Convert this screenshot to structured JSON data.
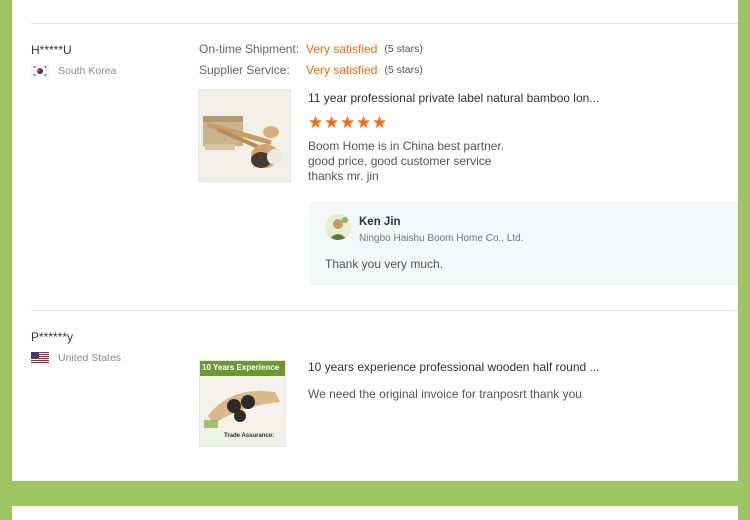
{
  "reviews": [
    {
      "user": "H*****U",
      "country": "South Korea",
      "ratings": [
        {
          "label": "On-time Shipment:",
          "value": "Very satisfied",
          "stars": "(5 stars)"
        },
        {
          "label": "Supplier Service:",
          "value": "Very satisfied",
          "stars": "(5 stars)"
        }
      ],
      "product_title": "11 year professional private label natural bamboo lon...",
      "star_rating": 5,
      "review_lines": [
        "Boom Home is in China best partner.",
        "good price, good customer service",
        "thanks mr. jin"
      ],
      "reply": {
        "name": "Ken Jin",
        "company": "Ningbo Haishu Boom Home Co., Ltd.",
        "text": "Thank you very much."
      }
    },
    {
      "user": "P******y",
      "country": "United States",
      "product_title": "10 years experience professional wooden half round ...",
      "review_lines": [
        "We need the original invoice for tranposrt thank you"
      ],
      "thumb_banner": "10 Years Experience",
      "thumb_caption": "Trade Assurance:"
    }
  ],
  "colors": {
    "accent": "#ff6a00",
    "frame": "#9dc562"
  },
  "icons": {
    "star": "filled-star-icon"
  }
}
